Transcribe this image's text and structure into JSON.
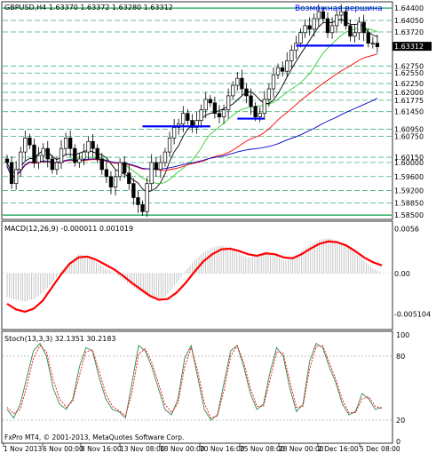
{
  "chart_data": [
    {
      "type": "candlestick",
      "title": "GBPUSD,H4 1.63370 1.63372 1.63280 1.63312",
      "annotation": "Возможная вершина",
      "ylim": [
        1.5843,
        1.6453
      ],
      "price_labels": [
        "1.64400",
        "1.64050",
        "1.63720",
        "1.63312",
        "1.62750",
        "1.62550",
        "1.62250",
        "1.62000",
        "1.61775",
        "1.61450",
        "1.60950",
        "1.60750",
        "1.60150",
        "1.60000",
        "1.59600",
        "1.59200",
        "1.58850",
        "1.58500"
      ],
      "current_price": "1.63312",
      "support_lines": [
        1.6333,
        1.6125,
        1.6103
      ],
      "key_levels": [
        1.644,
        1.585
      ],
      "x_tick_labels": [
        "1 Nov 2013",
        "6 Nov 00:00",
        "8 Nov 16:00",
        "13 Nov 08:00",
        "18 Nov 00:00",
        "20 Nov 16:00",
        "25 Nov 08:00",
        "28 Nov 00:00",
        "2 Dec 16:00",
        "5 Dec 08:00"
      ],
      "close_series": [
        1.6,
        1.594,
        1.598,
        1.603,
        1.607,
        1.605,
        1.6,
        1.602,
        1.604,
        1.601,
        1.598,
        1.6,
        1.604,
        1.607,
        1.604,
        1.6,
        1.601,
        1.603,
        1.606,
        1.604,
        1.601,
        1.598,
        1.596,
        1.593,
        1.596,
        1.6,
        1.597,
        1.594,
        1.59,
        1.588,
        1.586,
        1.594,
        1.6,
        1.598,
        1.6,
        1.603,
        1.607,
        1.61,
        1.611,
        1.614,
        1.612,
        1.61,
        1.612,
        1.615,
        1.618,
        1.617,
        1.614,
        1.613,
        1.615,
        1.619,
        1.622,
        1.624,
        1.621,
        1.619,
        1.616,
        1.613,
        1.614,
        1.618,
        1.621,
        1.625,
        1.627,
        1.626,
        1.629,
        1.632,
        1.634,
        1.637,
        1.639,
        1.638,
        1.641,
        1.643,
        1.641,
        1.637,
        1.639,
        1.642,
        1.643,
        1.639,
        1.636,
        1.637,
        1.64,
        1.637,
        1.634,
        1.634,
        1.633
      ]
    },
    {
      "type": "line",
      "title": "MACD(12,26,9) -0.000011 0.001019",
      "ylabels": [
        "0.0056",
        "0.00",
        "-0.005104"
      ],
      "ylim": [
        -0.0068,
        0.0062
      ],
      "histogram": [
        -0.003,
        -0.0033,
        -0.0035,
        -0.0032,
        -0.0024,
        -0.0012,
        0.0002,
        0.0015,
        0.0024,
        0.0022,
        0.0014,
        0.0006,
        0.0001,
        -0.0008,
        -0.0016,
        -0.0024,
        -0.003,
        -0.0034,
        -0.0026,
        -0.0012,
        0.0003,
        0.0016,
        0.0026,
        0.0032,
        0.0035,
        0.0031,
        0.0025,
        0.002,
        0.0022,
        0.0028,
        0.0023,
        0.0016,
        0.0018,
        0.0028,
        0.0036,
        0.0042,
        0.0044,
        0.0041,
        0.0035,
        0.0026,
        0.0016,
        0.0006,
        0.0001
      ],
      "signal": [
        -0.0038,
        -0.0045,
        -0.0048,
        -0.0044,
        -0.0034,
        -0.0018,
        -0.0002,
        0.0012,
        0.002,
        0.0021,
        0.0017,
        0.0011,
        0.0005,
        -0.0003,
        -0.0012,
        -0.002,
        -0.0028,
        -0.0033,
        -0.0032,
        -0.0024,
        -0.0012,
        0.0002,
        0.0015,
        0.0024,
        0.003,
        0.0031,
        0.0028,
        0.0024,
        0.0022,
        0.0025,
        0.0024,
        0.002,
        0.0019,
        0.0024,
        0.0031,
        0.0037,
        0.004,
        0.0039,
        0.0035,
        0.0028,
        0.002,
        0.0014,
        0.001
      ]
    },
    {
      "type": "line",
      "title": "Stoch(13,3,3) 32.1351 30.2183",
      "ylabels": [
        "100",
        "80",
        "20",
        "0"
      ],
      "ylim": [
        0,
        100
      ],
      "main": [
        30,
        22,
        35,
        60,
        85,
        92,
        80,
        50,
        35,
        30,
        40,
        70,
        88,
        85,
        60,
        40,
        30,
        28,
        22,
        55,
        90,
        85,
        70,
        50,
        30,
        25,
        40,
        78,
        90,
        60,
        30,
        20,
        25,
        55,
        85,
        90,
        70,
        45,
        30,
        35,
        65,
        88,
        80,
        50,
        28,
        35,
        75,
        92,
        88,
        70,
        55,
        35,
        25,
        28,
        45,
        40,
        30,
        32
      ],
      "signal": [
        32,
        26,
        30,
        52,
        78,
        90,
        84,
        58,
        40,
        32,
        38,
        62,
        84,
        86,
        66,
        45,
        33,
        29,
        24,
        46,
        82,
        87,
        74,
        55,
        35,
        27,
        36,
        70,
        88,
        66,
        36,
        22,
        24,
        48,
        80,
        90,
        74,
        50,
        33,
        33,
        58,
        84,
        83,
        56,
        32,
        33,
        68,
        89,
        90,
        74,
        58,
        39,
        27,
        27,
        40,
        42,
        33,
        31
      ]
    }
  ],
  "footer": "FxPro MT4, © 2001-2013, MetaQuotes Software Corp.",
  "colors": {
    "background": "#ffffff",
    "grid": "#3cb371",
    "candle": "#000000",
    "ma_fast": "#000000",
    "ma_green": "#32cd32",
    "ma_red": "#ff0000",
    "ma_blue": "#0000cd",
    "support": "#0000ff",
    "macd_signal": "#ff0000",
    "macd_hist": "#c0c0c0",
    "stoch_main": "#2e8b57",
    "stoch_signal": "#ff0000"
  }
}
